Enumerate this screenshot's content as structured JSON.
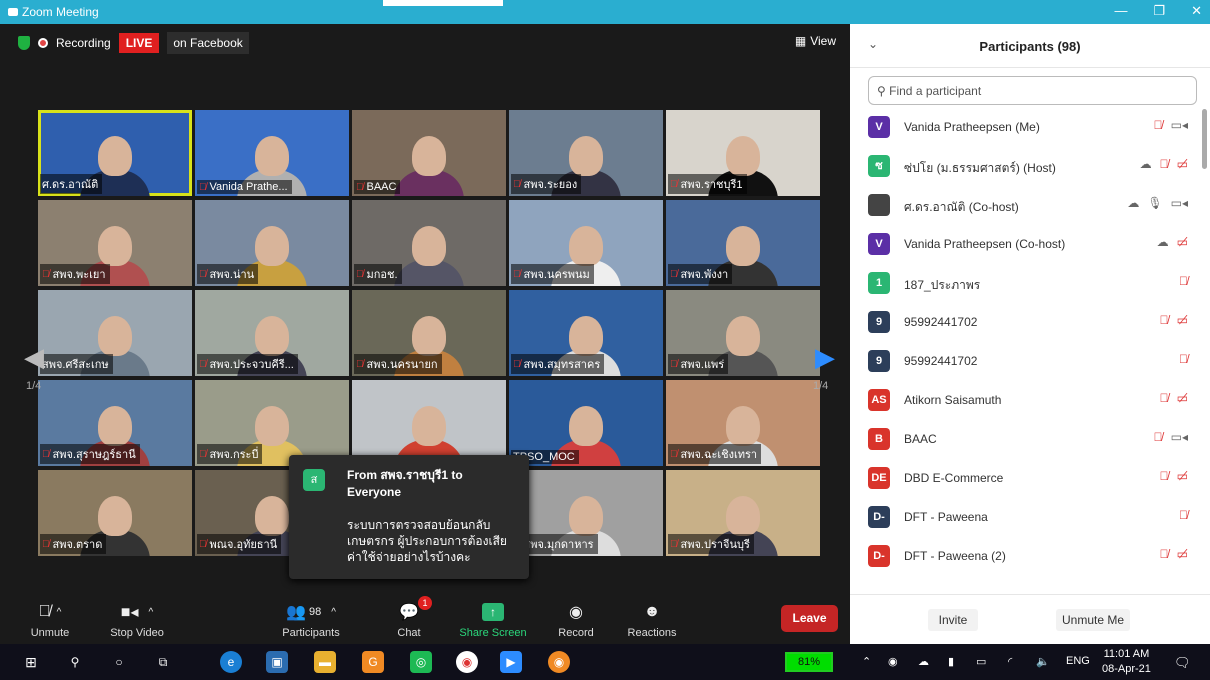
{
  "window": {
    "title": "Zoom Meeting"
  },
  "status": {
    "recording": "Recording",
    "live": "LIVE",
    "live_on": "on Facebook",
    "view": "View"
  },
  "grid": {
    "page_left": "1/4",
    "page_right": "1/4",
    "tiles": [
      {
        "name": "ศ.ดร.อาณัติ",
        "muted": false,
        "active": true,
        "bg": "#2f5fae",
        "body": "#1e2f55"
      },
      {
        "name": "Vanida Prathe...",
        "muted": true,
        "active": false,
        "bg": "#3a6fc6",
        "body": "#b0b0b0"
      },
      {
        "name": "BAAC",
        "muted": true,
        "active": false,
        "bg": "#7b6a5a",
        "body": "#6a3060"
      },
      {
        "name": "สพจ.ระยอง",
        "muted": true,
        "active": false,
        "bg": "#6c7d90",
        "body": "#334"
      },
      {
        "name": "สพจ.ราชบุรี1",
        "muted": true,
        "active": false,
        "bg": "#d8d4cc",
        "body": "#111"
      },
      {
        "name": "สพจ.พะเยา",
        "muted": true,
        "active": false,
        "bg": "#8c8070",
        "body": "#b05050"
      },
      {
        "name": "สพจ.น่าน",
        "muted": true,
        "active": false,
        "bg": "#7a8aa0",
        "body": "#c8a040"
      },
      {
        "name": "มกอช.",
        "muted": true,
        "active": false,
        "bg": "#6e6a66",
        "body": "#556"
      },
      {
        "name": "สพจ.นครพนม",
        "muted": true,
        "active": false,
        "bg": "#8fa4be",
        "body": "#eee"
      },
      {
        "name": "สพจ.พังงา",
        "muted": true,
        "active": false,
        "bg": "#4a6a9a",
        "body": "#333"
      },
      {
        "name": "สพจ.ศรีสะเกษ",
        "muted": false,
        "active": false,
        "bg": "#9aa6b0",
        "body": "#6a7a8a"
      },
      {
        "name": "สพจ.ประจวบคีรี...",
        "muted": true,
        "active": false,
        "bg": "#a0a8a0",
        "body": "#445"
      },
      {
        "name": "สพจ.นครนายก",
        "muted": true,
        "active": false,
        "bg": "#6a6858",
        "body": "#c08040"
      },
      {
        "name": "สพจ.สมุทรสาคร",
        "muted": true,
        "active": false,
        "bg": "#3060a0",
        "body": "#ddd"
      },
      {
        "name": "สพจ.แพร่",
        "muted": true,
        "active": false,
        "bg": "#8a8a80",
        "body": "#555"
      },
      {
        "name": "สพจ.สุราษฎร์ธานี",
        "muted": true,
        "active": false,
        "bg": "#5a7aa0",
        "body": "#a04040"
      },
      {
        "name": "สพจ.กระบี่",
        "muted": true,
        "active": false,
        "bg": "#9a9c8a",
        "body": "#e0c060"
      },
      {
        "name": "",
        "muted": false,
        "active": false,
        "bg": "#c0c4c8",
        "body": "#d04030"
      },
      {
        "name": "TPSO_MOC",
        "muted": false,
        "active": false,
        "bg": "#2a5a9a",
        "body": "#d04040"
      },
      {
        "name": "สพจ.ฉะเชิงเทรา",
        "muted": true,
        "active": false,
        "bg": "#c09070",
        "body": "#ddd"
      },
      {
        "name": "สพจ.ตราด",
        "muted": true,
        "active": false,
        "bg": "#8a7a60",
        "body": "#333"
      },
      {
        "name": "พณจ.อุทัยธานี",
        "muted": true,
        "active": false,
        "bg": "#6a6050",
        "body": "#445"
      },
      {
        "name": "",
        "muted": false,
        "active": false,
        "bg": "#777",
        "body": "#445"
      },
      {
        "name": "สพจ.มุกดาหาร",
        "muted": true,
        "active": false,
        "bg": "#a0a0a0",
        "body": "#ddd"
      },
      {
        "name": "สพจ.ปราจีนบุรี",
        "muted": true,
        "active": false,
        "bg": "#c8b088",
        "body": "#445"
      }
    ]
  },
  "chat_popup": {
    "avatar": "ส",
    "header": "From สพจ.ราชบุรี1 to Everyone",
    "message": "ระบบการตรวจสอบย้อนกลับ เกษตรกร ผู้ประกอบการต้องเสีย ค่าใช้จ่ายอย่างไรบ้างคะ"
  },
  "toolbar": {
    "unmute": "Unmute",
    "stop_video": "Stop Video",
    "participants": "Participants",
    "participants_count": "98",
    "chat": "Chat",
    "chat_badge": "1",
    "share": "Share Screen",
    "record": "Record",
    "reactions": "Reactions",
    "leave": "Leave"
  },
  "panel": {
    "title": "Participants (98)",
    "search_placeholder": "Find a participant",
    "invite": "Invite",
    "unmute_me": "Unmute Me",
    "participants": [
      {
        "avatar": "V",
        "color": "#5b2fa6",
        "name": "Vanida Pratheepsen (Me)",
        "icons": [
          "mic-muted",
          "video"
        ]
      },
      {
        "avatar": "ซ",
        "color": "#2bb673",
        "name": "ซ่ปโย (ม.ธรรมศาสตร์) (Host)",
        "icons": [
          "cloud",
          "mic-muted",
          "video-off"
        ]
      },
      {
        "avatar": "",
        "color": "#444",
        "name": "ศ.ดร.อาณัติ (Co-host)",
        "icons": [
          "cloud",
          "mic",
          "video"
        ]
      },
      {
        "avatar": "V",
        "color": "#5b2fa6",
        "name": "Vanida Pratheepsen (Co-host)",
        "icons": [
          "cloud",
          "video-off"
        ]
      },
      {
        "avatar": "1",
        "color": "#2bb673",
        "name": "187_ประภาพร",
        "icons": [
          "mic-muted"
        ]
      },
      {
        "avatar": "9",
        "color": "#2c3e5a",
        "name": "95992441702",
        "icons": [
          "mic-muted",
          "video-off"
        ]
      },
      {
        "avatar": "9",
        "color": "#2c3e5a",
        "name": "95992441702",
        "icons": [
          "mic-muted"
        ]
      },
      {
        "avatar": "AS",
        "color": "#d9342b",
        "name": "Atikorn Saisamuth",
        "icons": [
          "mic-muted",
          "video-off"
        ]
      },
      {
        "avatar": "B",
        "color": "#d9342b",
        "name": "BAAC",
        "icons": [
          "mic-muted",
          "video"
        ]
      },
      {
        "avatar": "DE",
        "color": "#d9342b",
        "name": "DBD E-Commerce",
        "icons": [
          "mic-muted",
          "video-off"
        ]
      },
      {
        "avatar": "D-",
        "color": "#2c3e5a",
        "name": "DFT - Paweena",
        "icons": [
          "mic-muted"
        ]
      },
      {
        "avatar": "D-",
        "color": "#d9342b",
        "name": "DFT - Paweena (2)",
        "icons": [
          "mic-muted",
          "video-off"
        ]
      }
    ]
  },
  "taskbar": {
    "battery": "81%",
    "lang": "ENG",
    "time": "11:01 AM",
    "date": "08-Apr-21"
  }
}
